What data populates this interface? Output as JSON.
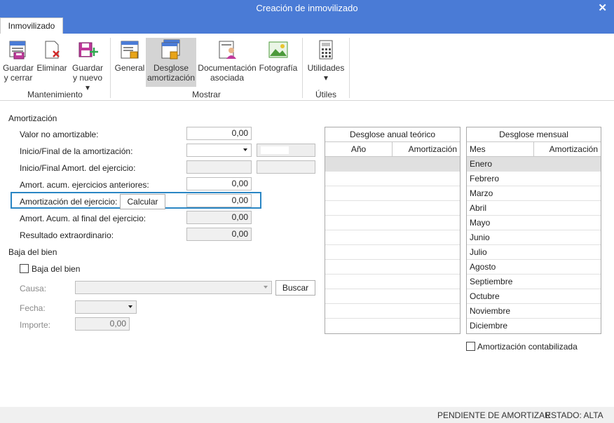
{
  "window": {
    "title": "Creación de inmovilizado"
  },
  "ribbon": {
    "tab": "Inmovilizado",
    "buttons": {
      "guardar_cerrar": [
        "Guardar",
        "y cerrar"
      ],
      "eliminar": [
        "Eliminar"
      ],
      "guardar_nuevo": [
        "Guardar",
        "y nuevo ▾"
      ],
      "general": [
        "General"
      ],
      "desglose": [
        "Desglose",
        "amortización"
      ],
      "documentacion": [
        "Documentación",
        "asociada"
      ],
      "fotografia": [
        "Fotografía"
      ],
      "utilidades": [
        "Utilidades",
        "▾"
      ]
    },
    "groups": {
      "mantenimiento": "Mantenimiento",
      "mostrar": "Mostrar",
      "utiles": "Útiles"
    }
  },
  "amortizacion": {
    "title": "Amortización",
    "valor_no_amortizable": {
      "label": "Valor no amortizable:",
      "value": "0,00"
    },
    "inicio_final": {
      "label": "Inicio/Final de la amortización:"
    },
    "inicio_final_ejercicio": {
      "label": "Inicio/Final Amort. del ejercicio:"
    },
    "acum_anteriores": {
      "label": "Amort. acum. ejercicios anteriores:",
      "value": "0,00"
    },
    "del_ejercicio": {
      "label": "Amortización del ejercicio:",
      "button": "Calcular",
      "value": "0,00"
    },
    "acum_final": {
      "label": "Amort. Acum. al final del ejercicio:",
      "value": "0,00"
    },
    "resultado": {
      "label": "Resultado extraordinario:",
      "value": "0,00"
    }
  },
  "baja": {
    "title": "Baja del bien",
    "checkbox_label": "Baja del bien",
    "causa_label": "Causa:",
    "buscar_button": "Buscar",
    "fecha_label": "Fecha:",
    "importe_label": "Importe:",
    "importe_value": "0,00"
  },
  "desglose_anual": {
    "title": "Desglose anual teórico",
    "columns": [
      "Año",
      "Amortización"
    ]
  },
  "desglose_mensual": {
    "title": "Desglose mensual",
    "columns": [
      "Mes",
      "Amortización"
    ],
    "months": [
      "Enero",
      "Febrero",
      "Marzo",
      "Abril",
      "Mayo",
      "Junio",
      "Julio",
      "Agosto",
      "Septiembre",
      "Octubre",
      "Noviembre",
      "Diciembre"
    ]
  },
  "amortizacion_contabilizada": "Amortización contabilizada",
  "status": {
    "left": "PENDIENTE DE AMORTIZAR",
    "right": "ESTADO: ALTA"
  }
}
